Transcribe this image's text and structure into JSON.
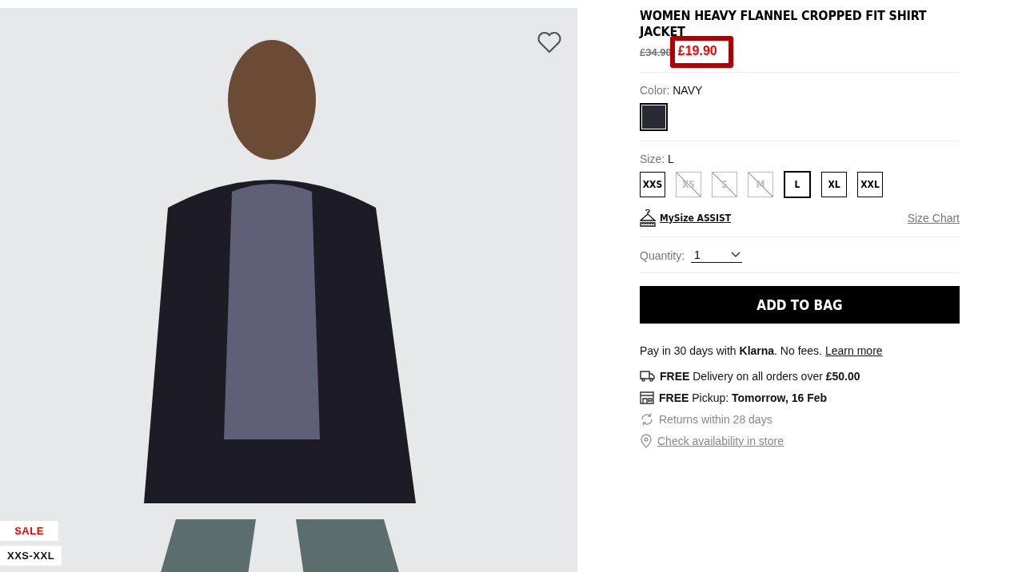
{
  "gallery": {
    "favorite": false,
    "badges": [
      {
        "label": "SALE",
        "kind": "sale"
      },
      {
        "label": "XXS-XXL",
        "kind": "range"
      }
    ]
  },
  "product": {
    "title": "WOMEN HEAVY FLANNEL CROPPED FIT SHIRT JACKET",
    "original_price": "£34.90",
    "sale_price": "£19.90",
    "highlighted": true
  },
  "color": {
    "label": "Color:",
    "value": "NAVY",
    "swatches": [
      {
        "color": "#2a2a36",
        "selected": true
      }
    ]
  },
  "size": {
    "label": "Size:",
    "value": "L",
    "options": [
      {
        "label": "XXS",
        "available": true,
        "selected": false
      },
      {
        "label": "XS",
        "available": false,
        "selected": false
      },
      {
        "label": "S",
        "available": false,
        "selected": false
      },
      {
        "label": "M",
        "available": false,
        "selected": false
      },
      {
        "label": "L",
        "available": true,
        "selected": true
      },
      {
        "label": "XL",
        "available": true,
        "selected": false
      },
      {
        "label": "XXL",
        "available": true,
        "selected": false
      }
    ],
    "assist": "MySize ASSIST",
    "chart": "Size Chart"
  },
  "quantity": {
    "label": "Quantity:",
    "value": "1"
  },
  "add_button": "ADD TO BAG",
  "klarna": {
    "text": "Pay in 30 days with **Klarna**. No fees.",
    "link": "Learn more"
  },
  "info": [
    {
      "kind": "delivery",
      "text": "**FREE** Delivery on all orders over **£50.00**",
      "muted": false,
      "link": false
    },
    {
      "kind": "pickup",
      "text": "**FREE** Pickup: **Tomorrow, 16 Feb**",
      "muted": false,
      "link": false
    },
    {
      "kind": "returns",
      "text": "Returns within 28 days",
      "muted": true,
      "link": false
    },
    {
      "kind": "store",
      "text": "Check availability in store",
      "muted": true,
      "link": true
    }
  ]
}
